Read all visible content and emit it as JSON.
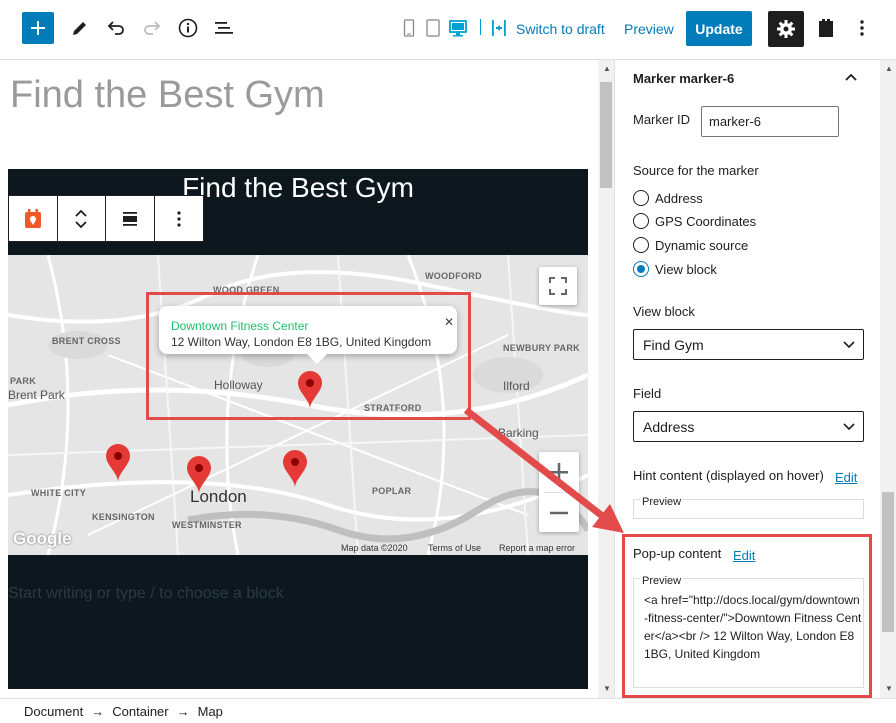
{
  "toolbar": {
    "switch_to_draft": "Switch to draft",
    "preview": "Preview",
    "update": "Update"
  },
  "editor": {
    "document_title": "Find the Best Gym",
    "container_heading": "Find the Best Gym",
    "placeholder": "Start writing or type / to choose a block"
  },
  "map": {
    "labels": [
      "WOOD GREEN",
      "WOODFORD",
      "BRENT CROSS",
      "NEWBURY PARK",
      "PARK",
      "STRATFORD",
      "WHITE CITY",
      "KENSINGTON",
      "WESTMINSTER",
      "POPLAR"
    ],
    "places": [
      "Brent Park",
      "Holloway",
      "Ilford",
      "Barking",
      "London"
    ],
    "infowindow": {
      "link": "Downtown Fitness Center",
      "address": "12 Wilton Way, London E8 1BG, United Kingdom"
    },
    "footer": {
      "map_data": "Map data ©2020",
      "terms": "Terms of Use",
      "report": "Report a map error"
    },
    "google": "Google"
  },
  "sidebar": {
    "panel_title": "Marker marker-6",
    "marker_id_label": "Marker ID",
    "marker_id_value": "marker-6",
    "source_label": "Source for the marker",
    "source_options": [
      "Address",
      "GPS Coordinates",
      "Dynamic source",
      "View block"
    ],
    "selected_source": "View block",
    "view_block_label": "View block",
    "view_block_value": "Find Gym",
    "field_label": "Field",
    "field_value": "Address",
    "hint_label": "Hint content (displayed on hover)",
    "hint_edit": "Edit",
    "hint_preview_legend": "Preview",
    "popup_label": "Pop-up content",
    "popup_edit": "Edit",
    "popup_preview_legend": "Preview",
    "popup_preview_code": "<a href=\"http://docs.local/gym/downtown-fitness-center/\">Downtown Fitness Center</a><br /> 12 Wilton Way, London E8 1BG, United Kingdom"
  },
  "breadcrumb": [
    "Document",
    "Container",
    "Map"
  ],
  "colors": {
    "accent": "#007cba",
    "annotation_red": "#e34b4b",
    "marker_red": "#e53935",
    "container_bg": "#0c181d"
  }
}
